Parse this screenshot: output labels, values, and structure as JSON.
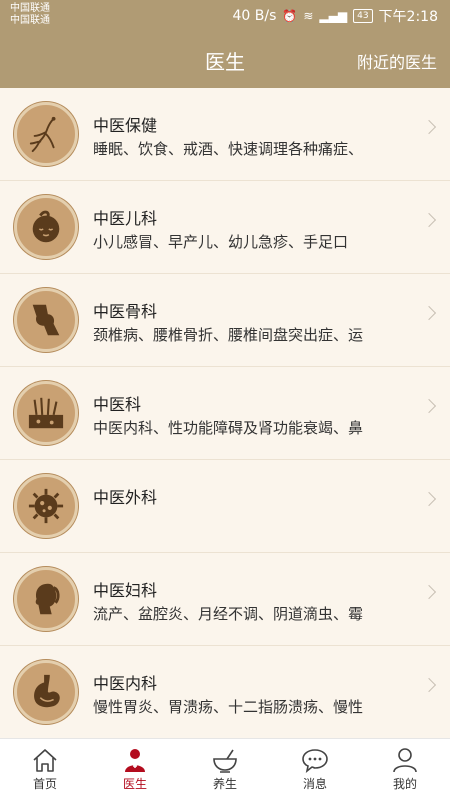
{
  "status": {
    "carrier1": "中国联通",
    "carrier2": "中国联通",
    "speed": "40 B/s",
    "battery": "43",
    "time": "下午2:18"
  },
  "nav": {
    "title": "医生",
    "right": "附近的医生"
  },
  "departments": [
    {
      "name": "中医保健",
      "desc": "睡眠、饮食、戒酒、快速调理各种痛症、",
      "icon": "ginseng-icon"
    },
    {
      "name": "中医儿科",
      "desc": "小儿感冒、早产儿、幼儿急疹、手足口",
      "icon": "baby-face-icon"
    },
    {
      "name": "中医骨科",
      "desc": "颈椎病、腰椎骨折、腰椎间盘突出症、运",
      "icon": "bone-joint-icon"
    },
    {
      "name": "中医科",
      "desc": "中医内科、性功能障碍及肾功能衰竭、鼻",
      "icon": "skin-hair-icon"
    },
    {
      "name": "中医外科",
      "desc": "",
      "icon": "cell-virus-icon"
    },
    {
      "name": "中医妇科",
      "desc": "流产、盆腔炎、月经不调、阴道滴虫、霉",
      "icon": "woman-head-icon"
    },
    {
      "name": "中医内科",
      "desc": "慢性胃炎、胃溃疡、十二指肠溃疡、慢性",
      "icon": "stomach-icon"
    }
  ],
  "tabs": [
    {
      "label": "首页",
      "icon": "home-icon"
    },
    {
      "label": "医生",
      "icon": "doctor-icon",
      "active": true
    },
    {
      "label": "养生",
      "icon": "herbal-bowl-icon"
    },
    {
      "label": "消息",
      "icon": "message-icon"
    },
    {
      "label": "我的",
      "icon": "profile-icon"
    }
  ],
  "colors": {
    "header": "#b09b74",
    "avatar": "#c9a173",
    "active_tab": "#b30c1e",
    "background": "#fbf5ec"
  }
}
